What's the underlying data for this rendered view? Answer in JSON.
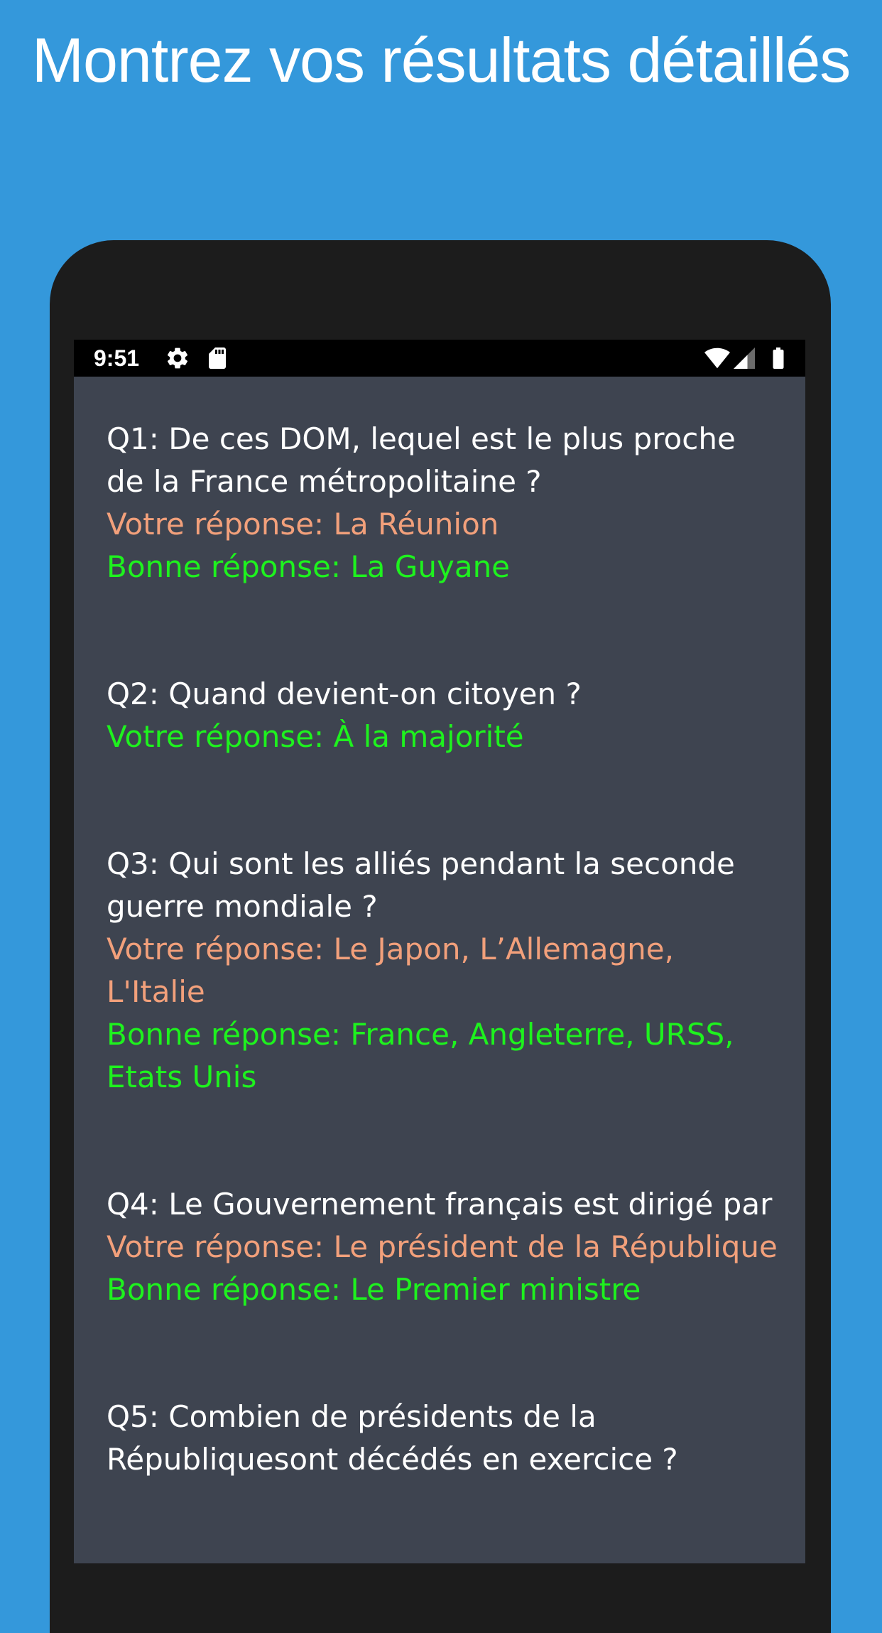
{
  "headline": "Montrez vos résultats détaillés",
  "status_bar": {
    "time": "9:51",
    "left_icons": [
      "gear-icon",
      "sd-card-icon"
    ],
    "right_icons": [
      "wifi-icon",
      "cell-signal-icon",
      "battery-icon"
    ]
  },
  "colors": {
    "background": "#3498db",
    "screen": "#3e4450",
    "wrong_answer": "#f2a07b",
    "correct_answer": "#1ef21e",
    "question": "#ffffff"
  },
  "results": [
    {
      "question": "Q1: De ces DOM, lequel est le plus proche de la France métropolitaine ?",
      "your_answer": "Votre réponse: La Réunion",
      "correct": false,
      "good_answer": "Bonne réponse: La Guyane"
    },
    {
      "question": "Q2: Quand devient-on citoyen ?",
      "your_answer": "Votre réponse: À la majorité",
      "correct": true
    },
    {
      "question": "Q3: Qui sont les alliés pendant la seconde guerre mondiale ?",
      "your_answer": "Votre réponse: Le Japon, L’Allemagne, L'Italie",
      "correct": false,
      "good_answer": "Bonne réponse: France, Angleterre, URSS, Etats Unis"
    },
    {
      "question": "Q4: Le Gouvernement français est dirigé par",
      "your_answer": "Votre réponse: Le président de la République",
      "correct": false,
      "good_answer": "Bonne réponse: Le Premier ministre"
    },
    {
      "question": "Q5: Combien de présidents de la Républiquesont décédés en exercice ?"
    }
  ]
}
